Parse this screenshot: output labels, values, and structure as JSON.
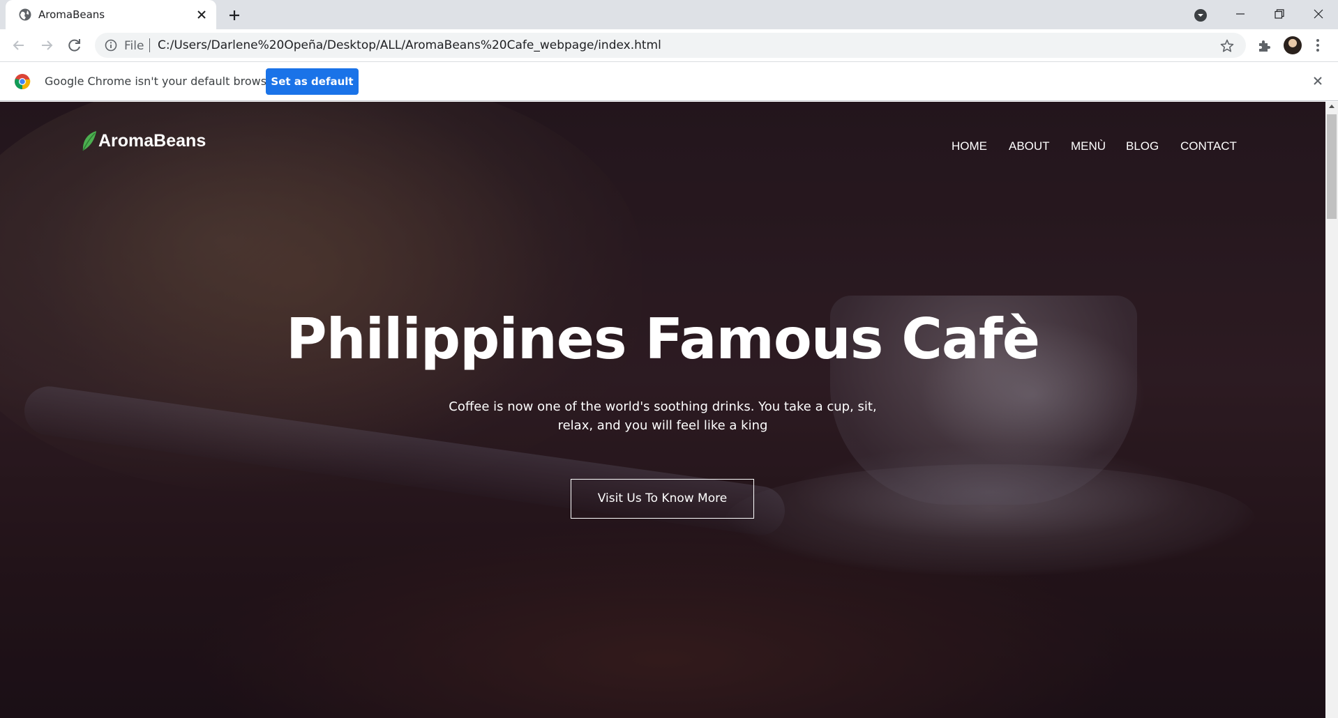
{
  "browser": {
    "tab_title": "AromaBeans",
    "file_label": "File",
    "url": "C:/Users/Darlene%20Opeña/Desktop/ALL/AromaBeans%20Cafe_webpage/index.html",
    "infobar_text": "Google Chrome isn't your default browser",
    "set_default_label": "Set as default"
  },
  "site": {
    "logo": "AromaBeans",
    "nav": {
      "home": "HOME",
      "about": "ABOUT",
      "menu": "MENÙ",
      "blog": "BLOG",
      "contact": "CONTACT"
    },
    "hero": {
      "title": "Philippines Famous Cafè",
      "subtitle": "Coffee is now one of the world's soothing drinks. You take a cup, sit, relax, and you will feel like a king",
      "button": "Visit Us To Know More"
    }
  },
  "colors": {
    "accent": "#1a73e8",
    "logo_leaf": "#4caf50"
  },
  "icons": [
    "globe-icon",
    "close-icon",
    "plus-icon",
    "tab-search-icon",
    "minimize-icon",
    "restore-icon",
    "back-icon",
    "forward-icon",
    "reload-icon",
    "info-icon",
    "star-icon",
    "puzzle-icon",
    "kebab-menu-icon",
    "chrome-logo-icon",
    "leaf-icon"
  ]
}
